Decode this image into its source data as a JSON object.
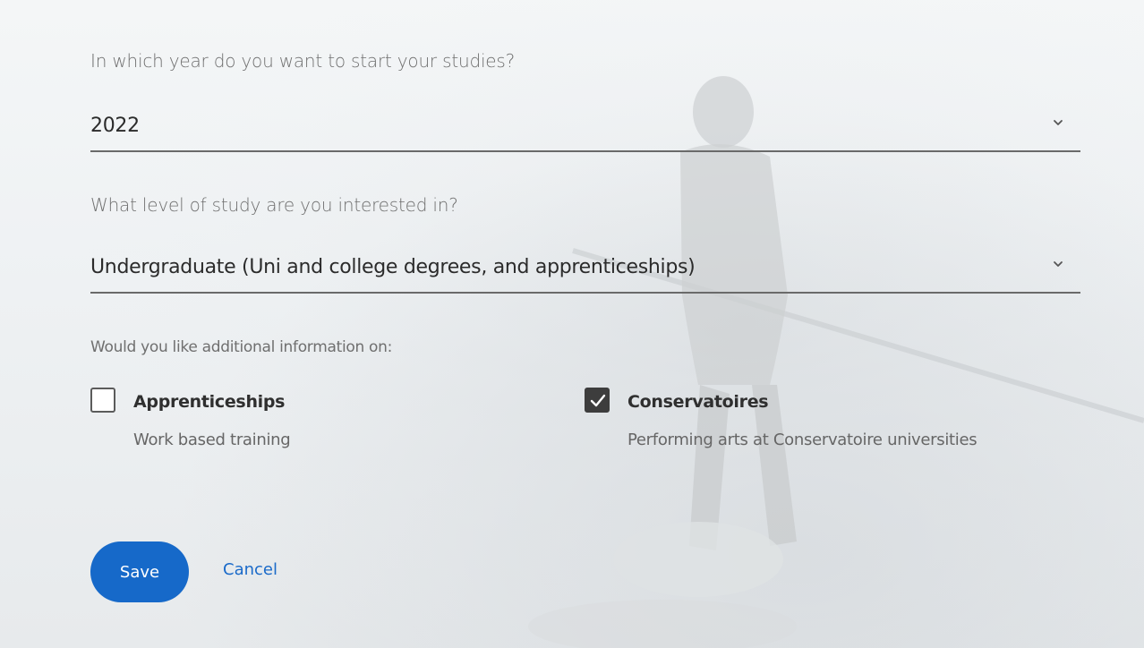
{
  "year_question": {
    "label": "In which year do you want to start your studies?",
    "value": "2022"
  },
  "level_question": {
    "label": "What level of study are you interested in?",
    "value": "Undergraduate (Uni and college degrees, and apprenticeships)"
  },
  "additional_info": {
    "label": "Would you like additional information on:",
    "options": [
      {
        "title": "Apprenticeships",
        "description": "Work based training",
        "checked": false
      },
      {
        "title": "Conservatoires",
        "description": "Performing arts at Conservatoire universities",
        "checked": true
      }
    ]
  },
  "actions": {
    "save_label": "Save",
    "cancel_label": "Cancel"
  },
  "colors": {
    "primary": "#1669c9",
    "checkbox_checked": "#3d3d3d"
  },
  "icons": {
    "select_arrow": "chevron-down-icon",
    "checkmark": "checkmark-icon"
  }
}
